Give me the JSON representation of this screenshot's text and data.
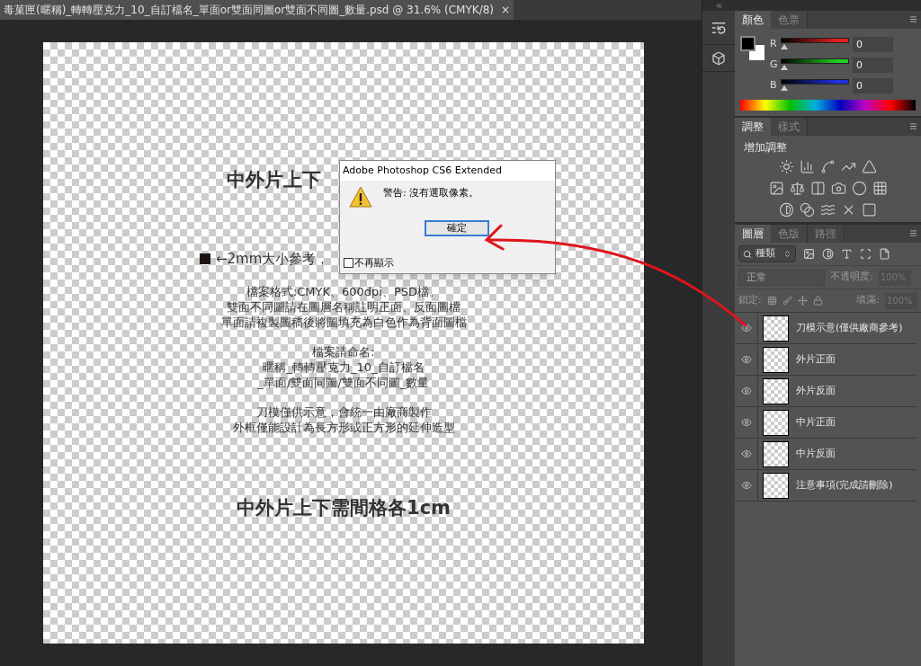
{
  "document_tab": {
    "title": "毒菓匣(暱稱)_轉轉壓克力_10_自訂檔名_單面or雙面同圖or雙面不同圖_數量.psd @ 31.6% (CMYK/8)",
    "close": "×"
  },
  "canvas": {
    "heading_top": "中外片上下",
    "size_note": "←2mm大小參考，",
    "paragraphs": [
      [
        "檔案格式:CMYK、600dpi、PSD檔。",
        "雙面不同圖請在圖層名稱註明正面、反面圖檔",
        "單面請複製圖稿後將圖填充為白色作為背面圖檔"
      ],
      [
        "檔案請命名:",
        "暱稱_轉轉壓克力_10_自訂檔名",
        "_單面/雙面同圖/雙面不同圖_數量"
      ],
      [
        "刀模僅供示意，會統一由廠商製作",
        "外框僅能設計為長方形或正方形的延伸造型"
      ]
    ],
    "heading_bottom": "中外片上下需間格各1cm"
  },
  "dialog": {
    "title": "Adobe Photoshop CS6 Extended",
    "message": "警告: 沒有選取像素。",
    "ok_button": "確定",
    "dont_show_again": {
      "label": "不再顯示",
      "checked": false
    }
  },
  "color_panel": {
    "tabs": [
      {
        "label": "顏色",
        "selected": true
      },
      {
        "label": "色票",
        "selected": false
      }
    ],
    "channels": [
      {
        "name": "R",
        "value": "0",
        "level": 0,
        "color": "#e02020"
      },
      {
        "name": "G",
        "value": "0",
        "level": 0,
        "color": "#20d020"
      },
      {
        "name": "B",
        "value": "0",
        "level": 0,
        "color": "#2030e0"
      }
    ]
  },
  "adjustments_panel": {
    "tabs": [
      {
        "label": "調整",
        "selected": true
      },
      {
        "label": "樣式",
        "selected": false
      }
    ],
    "heading": "增加調整"
  },
  "layers_panel": {
    "tabs": [
      {
        "label": "圖層",
        "selected": true
      },
      {
        "label": "色版",
        "selected": false
      },
      {
        "label": "路徑",
        "selected": false
      }
    ],
    "filter": "種類",
    "blend_mode": "正常",
    "opacity_label": "不透明度:",
    "opacity": "100%",
    "lock_label": "鎖定:",
    "fill_label": "填滿:",
    "fill": "100%",
    "layers": [
      {
        "name": "刀模示意(僅供廠商參考)",
        "visible": true
      },
      {
        "name": "外片正面",
        "visible": true
      },
      {
        "name": "外片反面",
        "visible": true
      },
      {
        "name": "中片正面",
        "visible": true
      },
      {
        "name": "中片反面",
        "visible": true
      },
      {
        "name": "注意事項(完成請刪除)",
        "visible": true
      }
    ]
  }
}
